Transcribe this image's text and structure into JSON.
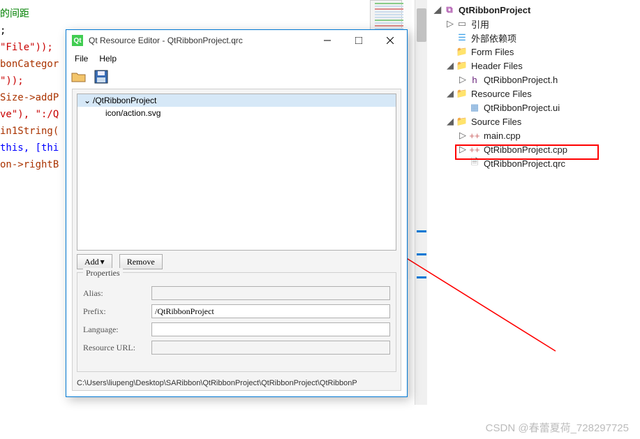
{
  "editor": {
    "code_lines": [
      {
        "text": "的间距",
        "cls": "cmt"
      },
      {
        "text": ";",
        "cls": ""
      },
      {
        "text": "\"File\"));",
        "cls": "str"
      },
      {
        "text": "",
        "cls": ""
      },
      {
        "text": "",
        "cls": ""
      },
      {
        "text": "bonCategor",
        "cls": "mth"
      },
      {
        "text": "",
        "cls": ""
      },
      {
        "text": "\"));",
        "cls": "str"
      },
      {
        "text": "",
        "cls": ""
      },
      {
        "text": "",
        "cls": ""
      },
      {
        "text": "Size->addP",
        "cls": "mth"
      },
      {
        "text": "ve\"), \":/Q",
        "cls": "str"
      },
      {
        "text": "in1String(",
        "cls": "mth"
      },
      {
        "text": "",
        "cls": ""
      },
      {
        "text": "this, [thi",
        "cls": "kw"
      },
      {
        "text": "",
        "cls": ""
      },
      {
        "text": "",
        "cls": ""
      },
      {
        "text": "",
        "cls": ""
      },
      {
        "text": "",
        "cls": ""
      },
      {
        "text": "",
        "cls": ""
      },
      {
        "text": "on->rightB",
        "cls": "mth"
      }
    ]
  },
  "dialog": {
    "window_title": "Qt Resource Editor - QtRibbonProject.qrc",
    "menu": {
      "file": "File",
      "help": "Help"
    },
    "tree": {
      "root": "/QtRibbonProject",
      "child": "icon/action.svg"
    },
    "buttons": {
      "add": "Add",
      "remove": "Remove"
    },
    "props": {
      "legend": "Properties",
      "alias_label": "Alias:",
      "alias_value": "",
      "prefix_label": "Prefix:",
      "prefix_value": "/QtRibbonProject",
      "language_label": "Language:",
      "language_value": "",
      "resource_url_label": "Resource URL:",
      "resource_url_value": ""
    },
    "statusbar": "C:\\Users\\liupeng\\Desktop\\SARibbon\\QtRibbonProject\\QtRibbonProject\\QtRibbonP"
  },
  "tree": {
    "root": "QtRibbonProject",
    "ref": "引用",
    "ext": "外部依赖项",
    "form": "Form Files",
    "header": "Header Files",
    "header_h": "QtRibbonProject.h",
    "resource": "Resource Files",
    "resource_ui": "QtRibbonProject.ui",
    "source": "Source Files",
    "main_cpp": "main.cpp",
    "proj_cpp": "QtRibbonProject.cpp",
    "qrc": "QtRibbonProject.qrc"
  },
  "watermark": "CSDN @春蕾夏荷_728297725"
}
